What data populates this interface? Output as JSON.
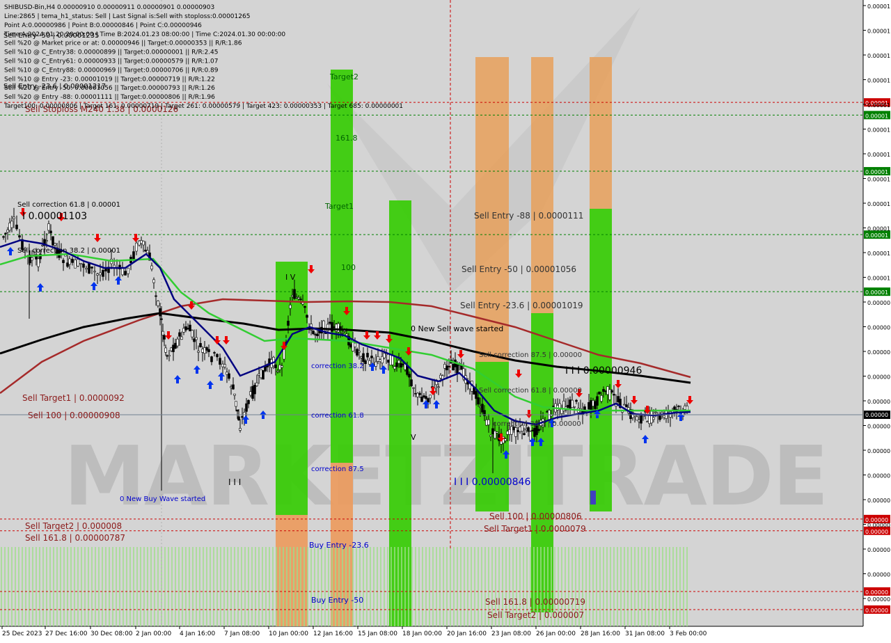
{
  "chart_data": {
    "type": "candlestick",
    "symbol": "SHIBUSD-Bin,H4",
    "ohlc_header": "SHIBUSD-Bin,H4  0.00000910 0.00000911 0.00000901 0.00000903",
    "info_lines": [
      "Line:2865 | tema_h1_status: Sell | Last Signal is:Sell with stoploss:0.00001265",
      "Point A:0.00000986 | Point B:0.00000846 | Point C:0.00000946",
      "Time A:2024.01.20 20:00:00 | Time B:2024.01.23 08:00:00 | Time C:2024.01.30 00:00:00",
      "Sell %20 @ Market price or at: 0.00000946 || Target:0.00000353 || R/R:1.86",
      "Sell %10 @ C_Entry38: 0.00000899 || Target:0.00000001 || R/R:2.45",
      "Sell %10 @ C_Entry61: 0.00000933 || Target:0.00000579 || R/R:1.07",
      "Sell %10 @ C_Entry88: 0.00000969 || Target:0.00000706 || R/R:0.89",
      "Sell %10 @ Entry -23: 0.00001019 || Target:0.00000719 || R/R:1.22",
      "Sell %20 @ Entry -50: 0.00001056 || Target:0.00000793 || R/R:1.26",
      "Sell %20 @ Entry -88: 0.00001111 || Target:0.00000806 || R/R:1.96",
      "Target100: 0.00000806 | Target 161: 0.00000719 | Target 261: 0.00000579 | Target 423: 0.00000353 | Target 685: 0.00000001"
    ],
    "x_tick_labels": [
      "25 Dec 2023",
      "27 Dec 16:00",
      "30 Dec 08:00",
      "2 Jan 00:00",
      "4 Jan 16:00",
      "7 Jan 08:00",
      "10 Jan 00:00",
      "12 Jan 16:00",
      "15 Jan 08:00",
      "18 Jan 00:00",
      "20 Jan 16:00",
      "23 Jan 08:00",
      "26 Jan 00:00",
      "28 Jan 16:00",
      "31 Jan 08:00",
      "3 Feb 00:00"
    ],
    "y_tick_label": "0.00000",
    "current_price_label": "0.00000",
    "y_range": [
      6.8e-06,
      1.33e-05
    ],
    "watermark": "MARKETZITRADE",
    "level_lines": [
      {
        "label": "Sell Stoploss M240 1.38 | 0.0000126",
        "price": 1.26e-05,
        "color": "#cc0000",
        "axis_label": "0.00001"
      },
      {
        "label": "",
        "price": 1.246e-05,
        "color": "#008000",
        "axis_label": "0.00001"
      },
      {
        "label": "",
        "price": 1.184e-05,
        "color": "#008000",
        "axis_label": "0.00001"
      },
      {
        "label": "",
        "price": 1.114e-05,
        "color": "#008000",
        "axis_label": "0.00001"
      },
      {
        "label": "",
        "price": 1.051e-05,
        "color": "#008000",
        "axis_label": "0.00001"
      },
      {
        "label": "Sell Target2 | 0.000008",
        "price": 8e-06,
        "color": "#cc0000",
        "axis_label": "0.00000"
      },
      {
        "label": "Sell 161.8 | 0.00000787",
        "price": 7.87e-06,
        "color": "#cc0000",
        "axis_label": "0.00000"
      },
      {
        "label": "",
        "price": 7.2e-06,
        "color": "#cc0000",
        "axis_label": "0.00000"
      },
      {
        "label": "",
        "price": 7e-06,
        "color": "#cc0000",
        "axis_label": "0.00000"
      }
    ],
    "text_labels": [
      {
        "text": "Sell correction 61.8 | 0.00001",
        "color": "#000"
      },
      {
        "text": "I 0.00001103",
        "color": "#000"
      },
      {
        "text": "Sell correction 38.2 | 0.00001",
        "color": "#000"
      },
      {
        "text": "Sell Entry -50 | 0.00001235",
        "color": "#000"
      },
      {
        "text": "Sell Entry -23.6 | 0.00001217",
        "color": "#000"
      },
      {
        "text": "Sell Target1 | 0.0000092",
        "color": "#8b1a1a"
      },
      {
        "text": "Sell 100 | 0.00000908",
        "color": "#8b1a1a"
      },
      {
        "text": "0 New Buy Wave started",
        "color": "#0000cc"
      },
      {
        "text": "I I I",
        "color": "#000"
      },
      {
        "text": "Target2",
        "color": "#006400"
      },
      {
        "text": "161.8",
        "color": "#006400"
      },
      {
        "text": "Target1",
        "color": "#006400"
      },
      {
        "text": "100",
        "color": "#006400"
      },
      {
        "text": "I V",
        "color": "#000"
      },
      {
        "text": "correction 38.2",
        "color": "#0000cc"
      },
      {
        "text": "correction 61.8",
        "color": "#0000cc"
      },
      {
        "text": "correction 87.5",
        "color": "#0000cc"
      },
      {
        "text": "Buy Entry -23.6",
        "color": "#0000cc"
      },
      {
        "text": "Buy Entry -50",
        "color": "#0000cc"
      },
      {
        "text": "0 New Sell wave started",
        "color": "#000"
      },
      {
        "text": "V",
        "color": "#000"
      },
      {
        "text": "Sell Entry -88 | 0.0000111",
        "color": "#333"
      },
      {
        "text": "Sell Entry -50 | 0.00001056",
        "color": "#333"
      },
      {
        "text": "Sell Entry -23.6 | 0.00001019",
        "color": "#333"
      },
      {
        "text": "Sell correction 87.5 | 0.00000",
        "color": "#333"
      },
      {
        "text": "Sell correction 61.8 | 0.00000",
        "color": "#333"
      },
      {
        "text": "correction 38.2 | 0.00000",
        "color": "#333"
      },
      {
        "text": "I I I 0.00000946",
        "color": "#000"
      },
      {
        "text": "I I I 0.00000846",
        "color": "#0000cc"
      },
      {
        "text": "Sell 100 | 0.00000806",
        "color": "#8b1a1a"
      },
      {
        "text": "Sell Target1 | 0.0000079",
        "color": "#8b1a1a"
      },
      {
        "text": "Sell 161.8 | 0.00000719",
        "color": "#8b1a1a"
      },
      {
        "text": "Sell Target2 | 0.000007",
        "color": "#8b1a1a"
      }
    ],
    "series": [
      {
        "name": "tema_h1",
        "color": "#000080"
      },
      {
        "name": "ma_green",
        "color": "#32cd32"
      },
      {
        "name": "ma_black",
        "color": "#000000"
      },
      {
        "name": "ma_red",
        "color": "#a52a2a"
      }
    ],
    "grid": false
  }
}
